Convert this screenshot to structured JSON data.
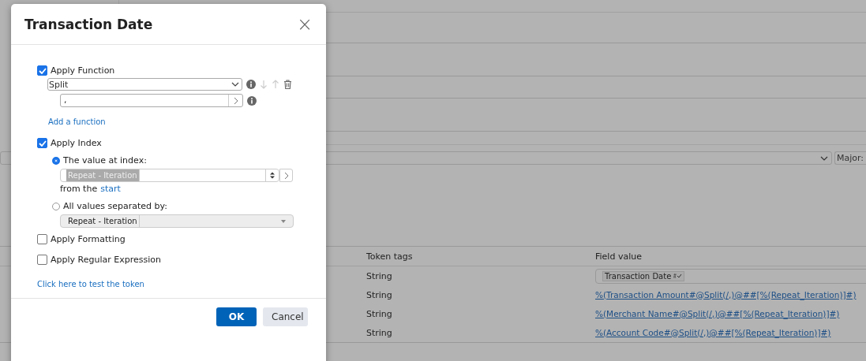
{
  "background": {
    "select_row": {
      "label": "Major:"
    },
    "table": {
      "columns": [
        "Token tags",
        "Field value"
      ],
      "rows": [
        {
          "kind": "tag",
          "tag": "String",
          "value": "Transaction Date"
        },
        {
          "kind": "link",
          "tag": "String",
          "value": "%(Transaction Amount#@Split(/,)@##[%(Repeat_Iteration)]#)"
        },
        {
          "kind": "link",
          "tag": "String",
          "value": "%(Merchant Name#@Split(/,)@##[%(Repeat_Iteration)]#)"
        },
        {
          "kind": "link",
          "tag": "String",
          "value": "%(Account Code#@Split(/,)@##[%(Repeat_Iteration)]#)"
        }
      ]
    }
  },
  "dialog": {
    "title": "Transaction Date",
    "close": "×",
    "apply_function": {
      "label": "Apply Function",
      "checked": true,
      "function": "Split",
      "argument": ",",
      "add_link": "Add a function"
    },
    "apply_index": {
      "label": "Apply Index",
      "checked": true,
      "options": [
        {
          "label": "The value at index:",
          "selected": true,
          "token": "Repeat - Iteration",
          "note": "from the",
          "note_link": "start"
        },
        {
          "label": "All values separated by:",
          "selected": false,
          "token": "Repeat - Iteration"
        }
      ]
    },
    "apply_formatting": {
      "label": "Apply Formatting",
      "checked": false
    },
    "apply_regex": {
      "label": "Apply Regular Expression",
      "checked": false
    },
    "test_link": "Click here to test the token",
    "buttons": [
      {
        "kind": "primary",
        "label": "OK"
      },
      {
        "kind": "secondary",
        "label": "Cancel"
      }
    ]
  }
}
